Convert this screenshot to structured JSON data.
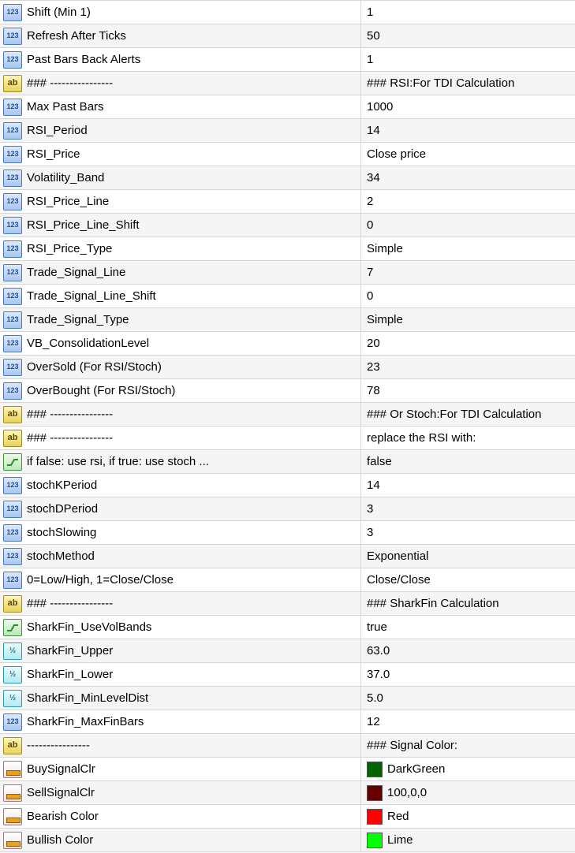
{
  "rows": [
    {
      "icon": "int-icon",
      "name": "Shift (Min 1)",
      "value": "1"
    },
    {
      "icon": "int-icon",
      "name": "Refresh After Ticks",
      "value": "50"
    },
    {
      "icon": "int-icon",
      "name": "Past Bars Back Alerts",
      "value": "1"
    },
    {
      "icon": "string-icon",
      "name": "### ----------------",
      "value": "### RSI:For TDI Calculation"
    },
    {
      "icon": "int-icon",
      "name": "Max Past Bars",
      "value": "1000"
    },
    {
      "icon": "int-icon",
      "name": "RSI_Period",
      "value": "14"
    },
    {
      "icon": "int-icon",
      "name": "RSI_Price",
      "value": "Close price"
    },
    {
      "icon": "int-icon",
      "name": "Volatility_Band",
      "value": "34"
    },
    {
      "icon": "int-icon",
      "name": "RSI_Price_Line",
      "value": "2"
    },
    {
      "icon": "int-icon",
      "name": "RSI_Price_Line_Shift",
      "value": "0"
    },
    {
      "icon": "int-icon",
      "name": "RSI_Price_Type",
      "value": "Simple"
    },
    {
      "icon": "int-icon",
      "name": "Trade_Signal_Line",
      "value": "7"
    },
    {
      "icon": "int-icon",
      "name": "Trade_Signal_Line_Shift",
      "value": "0"
    },
    {
      "icon": "int-icon",
      "name": "Trade_Signal_Type",
      "value": "Simple"
    },
    {
      "icon": "int-icon",
      "name": "VB_ConsolidationLevel",
      "value": "20"
    },
    {
      "icon": "int-icon",
      "name": "OverSold (For RSI/Stoch)",
      "value": "23"
    },
    {
      "icon": "int-icon",
      "name": "OverBought (For RSI/Stoch)",
      "value": "78"
    },
    {
      "icon": "string-icon",
      "name": "### ----------------",
      "value": "### Or Stoch:For TDI Calculation"
    },
    {
      "icon": "string-icon",
      "name": "### ----------------",
      "value": "replace the RSI with:"
    },
    {
      "icon": "bool-icon",
      "name": "if false: use rsi, if true: use stoch ...",
      "value": "false"
    },
    {
      "icon": "int-icon",
      "name": "stochKPeriod",
      "value": "14"
    },
    {
      "icon": "int-icon",
      "name": "stochDPeriod",
      "value": "3"
    },
    {
      "icon": "int-icon",
      "name": "stochSlowing",
      "value": "3"
    },
    {
      "icon": "int-icon",
      "name": "stochMethod",
      "value": "Exponential"
    },
    {
      "icon": "int-icon",
      "name": "0=Low/High, 1=Close/Close",
      "value": "Close/Close"
    },
    {
      "icon": "string-icon",
      "name": "### ----------------",
      "value": "### SharkFin Calculation"
    },
    {
      "icon": "bool-icon",
      "name": "SharkFin_UseVolBands",
      "value": "true"
    },
    {
      "icon": "double-icon",
      "name": "SharkFin_Upper",
      "value": "63.0"
    },
    {
      "icon": "double-icon",
      "name": "SharkFin_Lower",
      "value": "37.0"
    },
    {
      "icon": "double-icon",
      "name": "SharkFin_MinLevelDist",
      "value": "5.0"
    },
    {
      "icon": "int-icon",
      "name": "SharkFin_MaxFinBars",
      "value": "12"
    },
    {
      "icon": "string-icon",
      "name": "----------------",
      "value": "### Signal Color:"
    },
    {
      "icon": "color-icon",
      "name": "BuySignalClr",
      "value": "DarkGreen",
      "swatch": "#006400"
    },
    {
      "icon": "color-icon",
      "name": "SellSignalClr",
      "value": "100,0,0",
      "swatch": "#640000"
    },
    {
      "icon": "color-icon",
      "name": "Bearish Color",
      "value": "Red",
      "swatch": "#ff0000"
    },
    {
      "icon": "color-icon",
      "name": "Bullish Color",
      "value": "Lime",
      "swatch": "#00ff00"
    }
  ]
}
